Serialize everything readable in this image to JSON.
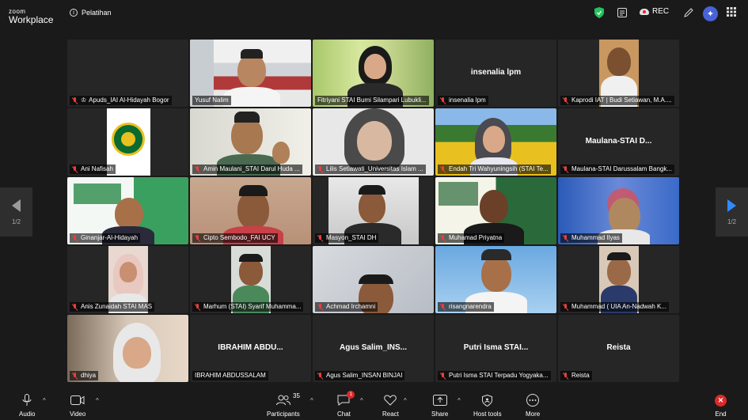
{
  "app": {
    "logo_top": "zoom",
    "logo_bottom": "Workplace",
    "meeting_title": "Pelatihan"
  },
  "topbar": {
    "rec_label": "REC",
    "icons": [
      "shield-icon",
      "notes-icon",
      "cloud-record-icon",
      "pen-icon",
      "ai-companion-icon",
      "apps-grid-icon"
    ]
  },
  "pagination": {
    "left": "1/2",
    "right": "1/2"
  },
  "tiles": [
    {
      "name": "Apuds_IAI Al-Hidayah Bogor",
      "bigname": "",
      "video": false,
      "host": true
    },
    {
      "name": "Yusuf Nalim",
      "bigname": "",
      "video": true,
      "active": true
    },
    {
      "name": "Fitriyani STAI Bumi Silampari Lubukli...",
      "bigname": "",
      "video": true
    },
    {
      "name": "insenalia lpm",
      "bigname": "insenalia lpm",
      "video": false
    },
    {
      "name": "Kaprodi IAT | Budi Setiawan, M.A....",
      "bigname": "",
      "video": true
    },
    {
      "name": "Ani Nafisah",
      "bigname": "",
      "video": true
    },
    {
      "name": "Amin Maulani_STAI Darul Huda ...",
      "bigname": "",
      "video": true
    },
    {
      "name": "Lilis Setiawati_Universitas Islam ...",
      "bigname": "",
      "video": true
    },
    {
      "name": "Endah Tri Wahyuningsih (STAI Te...",
      "bigname": "",
      "video": true
    },
    {
      "name": "Maulana-STAI Darussalam Bangk...",
      "bigname": "Maulana-STAI  D...",
      "video": false
    },
    {
      "name": "Ginanjar-Al-Hidayah",
      "bigname": "",
      "video": true
    },
    {
      "name": "Cipto Sembodo_FAI UCY",
      "bigname": "",
      "video": true
    },
    {
      "name": "Masyon_STAI DH",
      "bigname": "",
      "video": true
    },
    {
      "name": "Muhamad Priyatna",
      "bigname": "",
      "video": true
    },
    {
      "name": "Muhammad Ilyas",
      "bigname": "",
      "video": true
    },
    {
      "name": "Anis Zunaidah STAI MAS",
      "bigname": "",
      "video": true
    },
    {
      "name": "Marhum (STAI) Syarif Muhamma...",
      "bigname": "",
      "video": true
    },
    {
      "name": "Achmad Irchamni",
      "bigname": "",
      "video": true
    },
    {
      "name": "risangnarendra",
      "bigname": "",
      "video": true
    },
    {
      "name": "Muhammad ( UIA An-Nadwah K...",
      "bigname": "",
      "video": true
    },
    {
      "name": "dhiya",
      "bigname": "",
      "video": true
    },
    {
      "name": "IBRAHIM ABDUSSALAM",
      "bigname": "IBRAHIM  ABDU...",
      "video": false,
      "unmuted": true
    },
    {
      "name": "Agus Salim_INSAN BINJAI",
      "bigname": "Agus  Salim_INS...",
      "video": false
    },
    {
      "name": "Putri Isma STAI Terpadu Yogyaka...",
      "bigname": "Putri  Isma  STAI...",
      "video": false
    },
    {
      "name": "Reista",
      "bigname": "Reista",
      "video": false
    }
  ],
  "toolbar": {
    "audio": "Audio",
    "video": "Video",
    "participants": "Participants",
    "participants_count": "35",
    "chat": "Chat",
    "chat_badge": "1",
    "react": "React",
    "share": "Share",
    "host_tools": "Host tools",
    "more": "More",
    "end": "End"
  }
}
